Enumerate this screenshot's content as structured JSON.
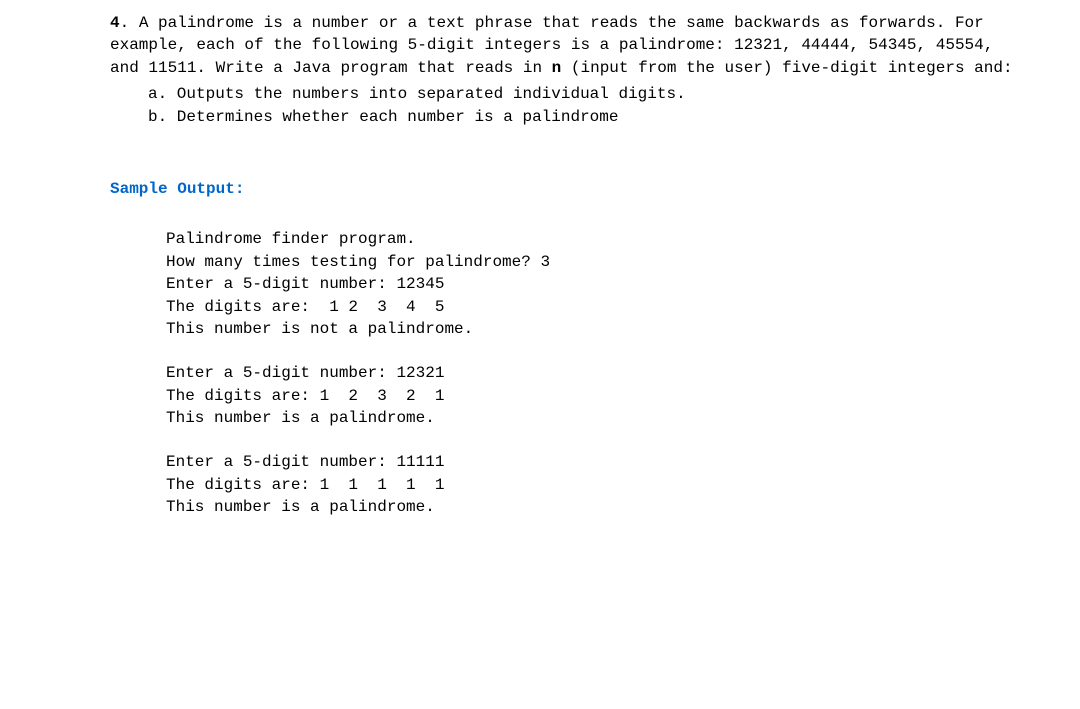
{
  "problem": {
    "number": "4",
    "text_parts": {
      "before_n": ". A palindrome is a number or a text phrase that reads the same backwards as forwards. For example, each of the following 5-digit integers is a palindrome: 12321, 44444, 54345, 45554, and 11511. Write a Java program that reads in ",
      "n": "n",
      "after_n": " (input from the user) five-digit integers and:"
    },
    "sub_items": [
      "a. Outputs the numbers into separated individual digits.",
      "b. Determines whether each number is a palindrome"
    ]
  },
  "sample_output": {
    "heading": "Sample Output:",
    "intro_lines": [
      "Palindrome finder program.",
      "How many times testing for palindrome? 3"
    ],
    "runs": [
      {
        "lines": [
          "Enter a 5-digit number: 12345",
          "The digits are:  1 2  3  4  5",
          "This number is not a palindrome."
        ]
      },
      {
        "lines": [
          "Enter a 5-digit number: 12321",
          "The digits are: 1  2  3  2  1",
          "This number is a palindrome."
        ]
      },
      {
        "lines": [
          "Enter a 5-digit number: 11111",
          "The digits are: 1  1  1  1  1",
          "This number is a palindrome."
        ]
      }
    ]
  }
}
